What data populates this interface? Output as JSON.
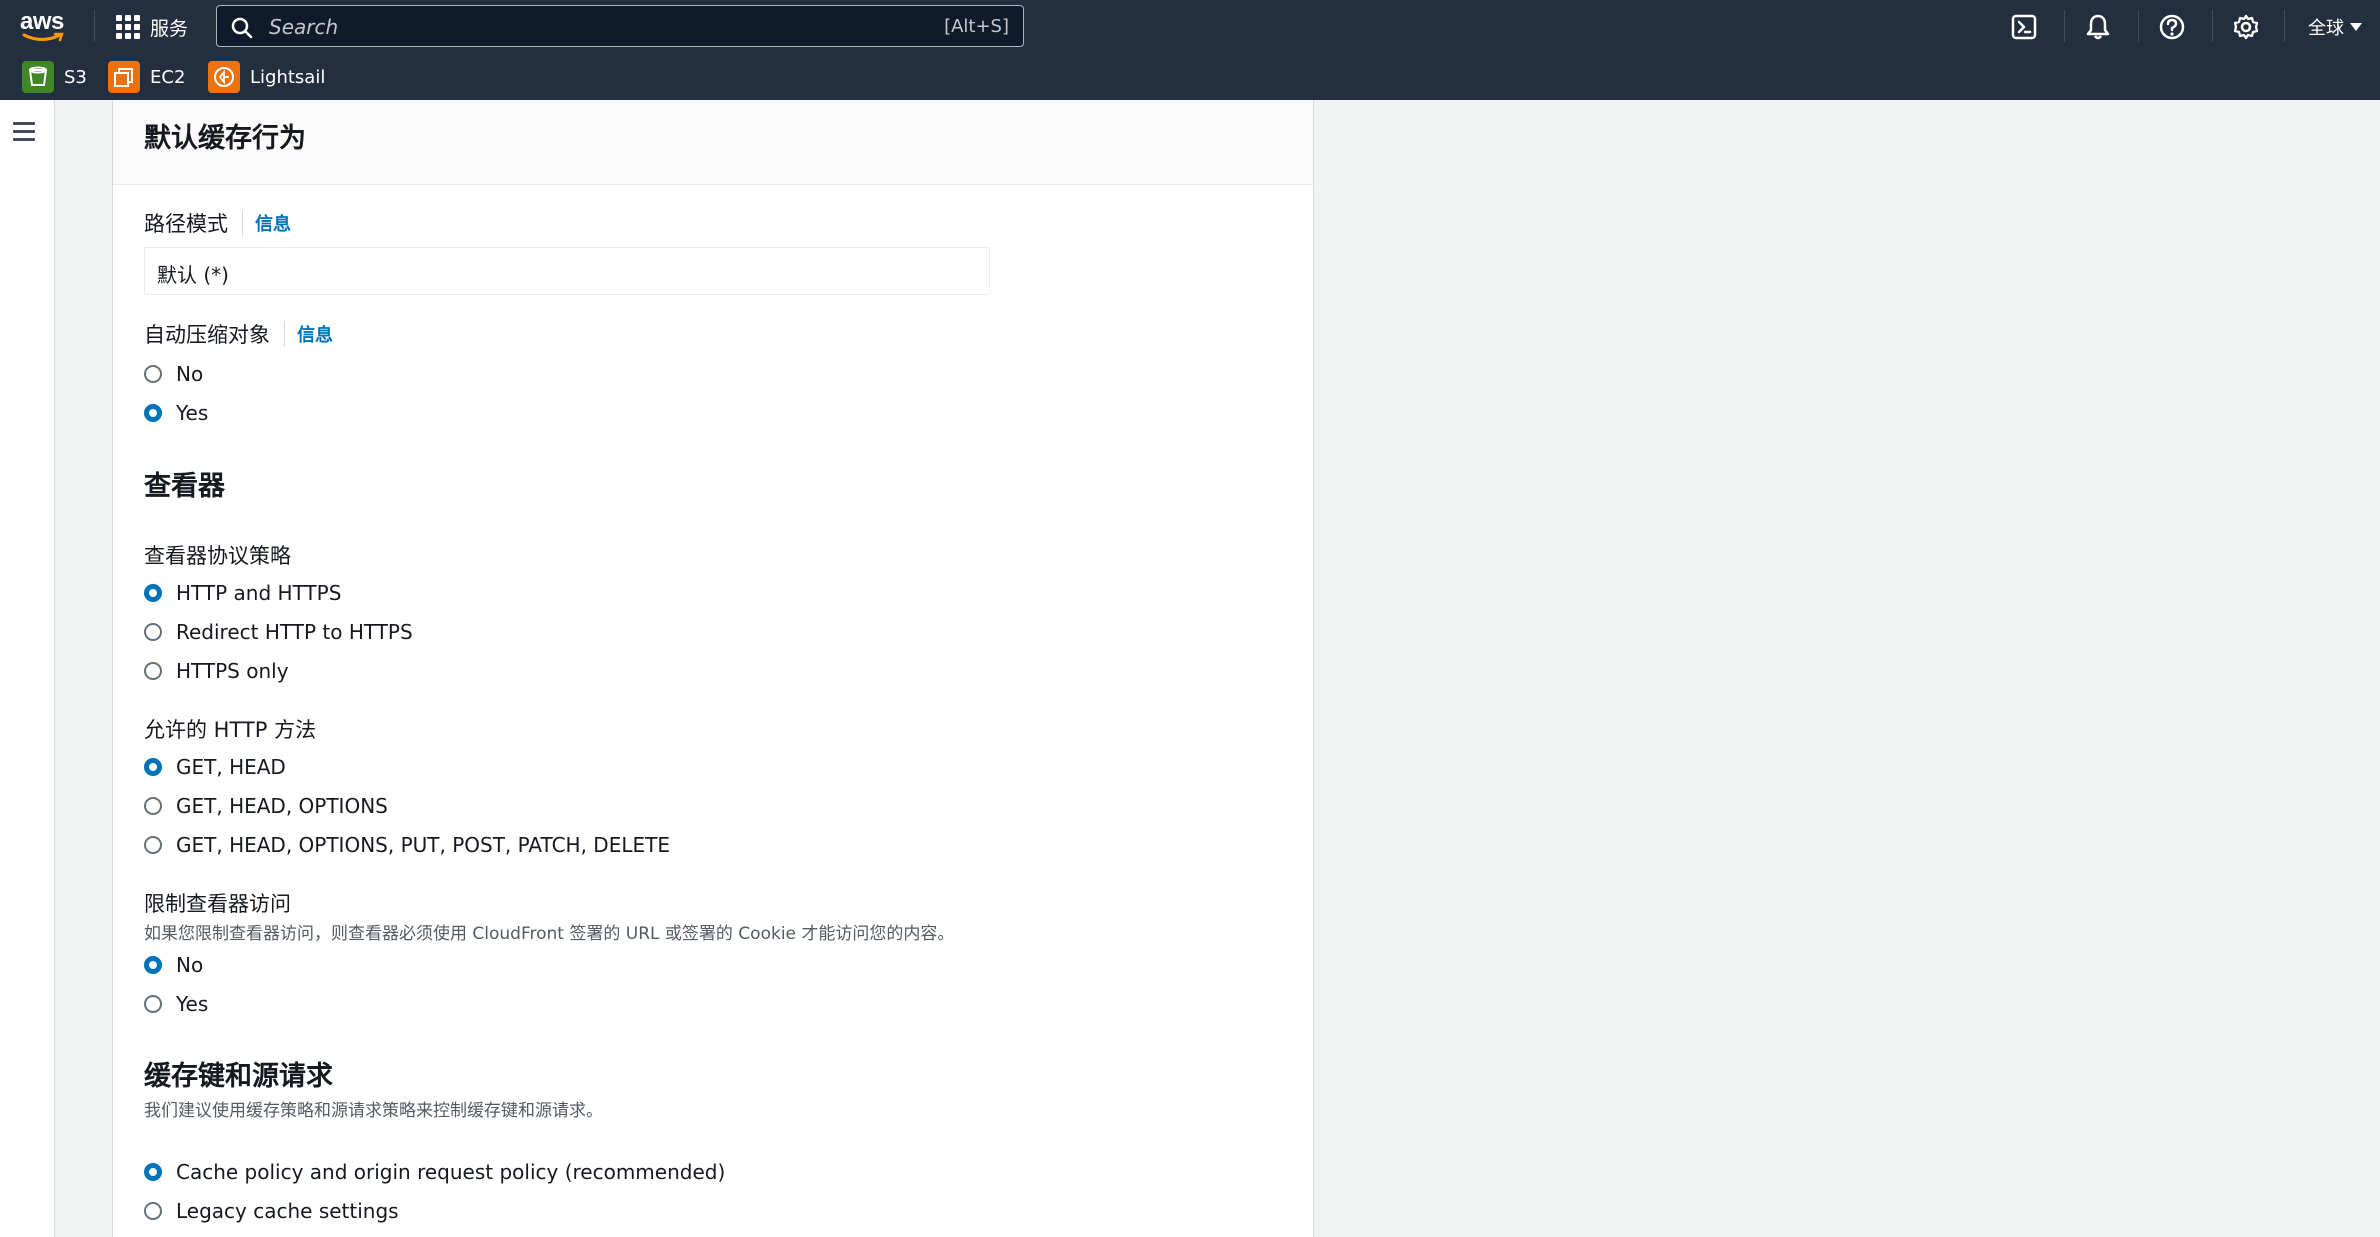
{
  "nav": {
    "logo_text": "aws",
    "services_label": "服务",
    "search_placeholder": "Search",
    "search_shortcut": "[Alt+S]",
    "region_label": "全球",
    "favorites": [
      {
        "label": "S3",
        "color": "#3f8624"
      },
      {
        "label": "EC2",
        "color": "#ec7211"
      },
      {
        "label": "Lightsail",
        "color": "#ec7211"
      }
    ],
    "icons": [
      "cloudshell-icon",
      "notifications-icon",
      "help-icon",
      "settings-icon"
    ]
  },
  "panel": {
    "title": "默认缓存行为",
    "path_pattern": {
      "label": "路径模式",
      "info": "信息",
      "value": "默认 (*)"
    },
    "compress": {
      "label": "自动压缩对象",
      "info": "信息",
      "options": [
        {
          "label": "No",
          "selected": false
        },
        {
          "label": "Yes",
          "selected": true
        }
      ]
    },
    "viewer": {
      "heading": "查看器",
      "protocol": {
        "label": "查看器协议策略",
        "options": [
          {
            "label": "HTTP and HTTPS",
            "selected": true
          },
          {
            "label": "Redirect HTTP to HTTPS",
            "selected": false
          },
          {
            "label": "HTTPS only",
            "selected": false
          }
        ]
      },
      "methods": {
        "label": "允许的 HTTP 方法",
        "options": [
          {
            "label": "GET, HEAD",
            "selected": true
          },
          {
            "label": "GET, HEAD, OPTIONS",
            "selected": false
          },
          {
            "label": "GET, HEAD, OPTIONS, PUT, POST, PATCH, DELETE",
            "selected": false
          }
        ]
      },
      "restrict": {
        "label": "限制查看器访问",
        "description": "如果您限制查看器访问，则查看器必须使用 CloudFront 签署的 URL 或签署的 Cookie 才能访问您的内容。",
        "options": [
          {
            "label": "No",
            "selected": true
          },
          {
            "label": "Yes",
            "selected": false
          }
        ]
      }
    },
    "cache": {
      "heading": "缓存键和源请求",
      "description": "我们建议使用缓存策略和源请求策略来控制缓存键和源请求。",
      "options": [
        {
          "label": "Cache policy and origin request policy (recommended)",
          "selected": true
        },
        {
          "label": "Legacy cache settings",
          "selected": false
        }
      ]
    }
  },
  "colors": {
    "nav_bg": "#232f3e",
    "accent": "#0073bb",
    "page_bg": "#f2f3f3"
  }
}
